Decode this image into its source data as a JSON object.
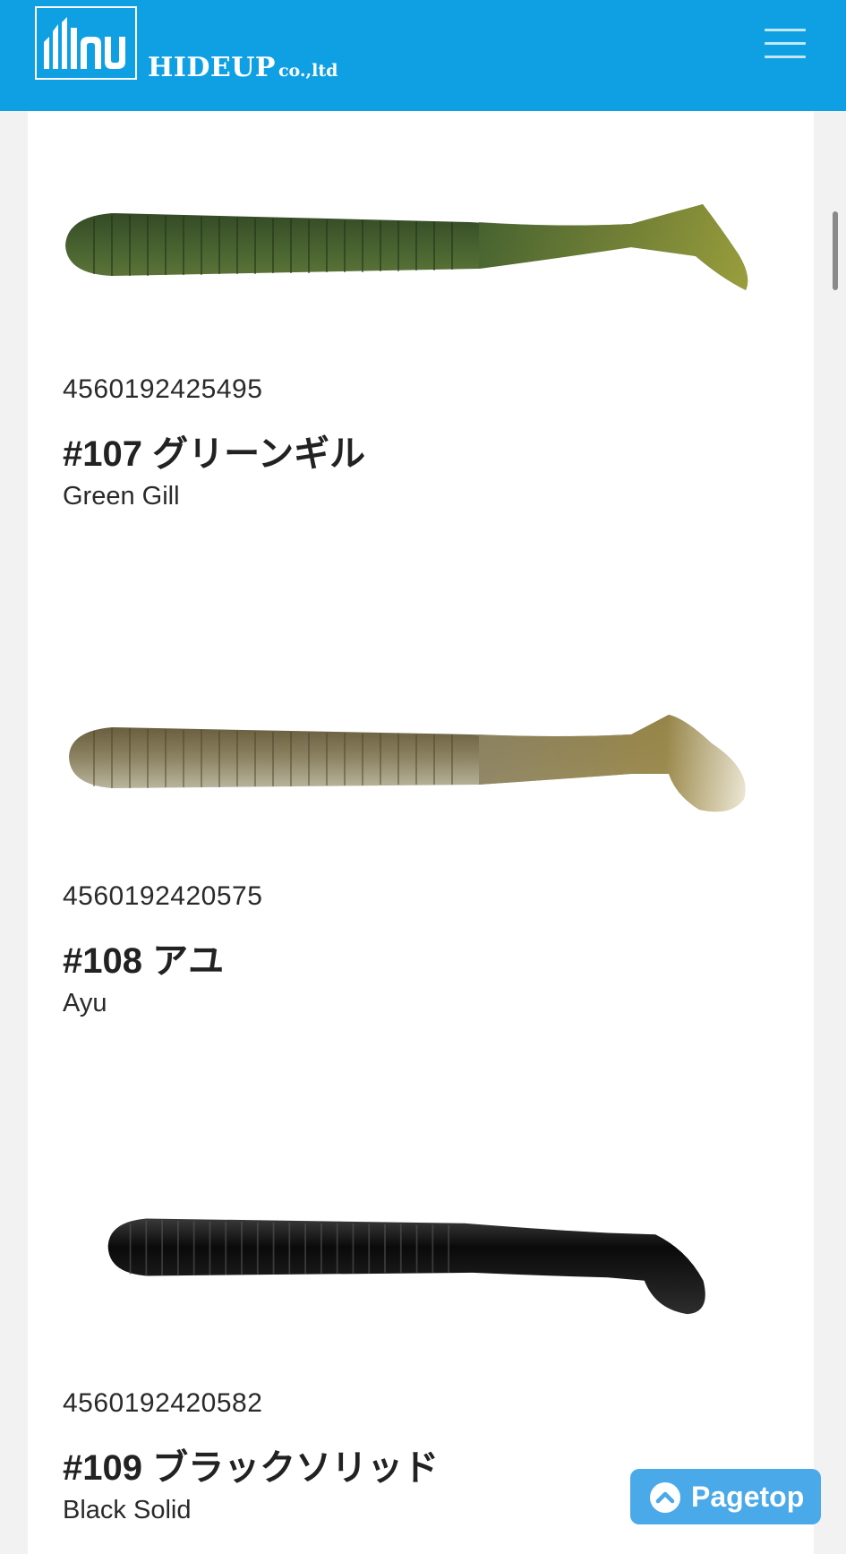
{
  "header": {
    "brand_name": "HIDEUP",
    "brand_suffix": "co.,ltd",
    "logo_letters": "hu",
    "menu_icon": "hamburger-menu-icon",
    "color": "#0fa0e3"
  },
  "products": [
    {
      "jan": "4560192425495",
      "title": "#107 グリーンギル",
      "name_en": "Green Gill",
      "lure_colors": {
        "body": "#4a6531",
        "back": "#2f4423",
        "belly": "#667c3c",
        "tail": "#a3a43d"
      }
    },
    {
      "jan": "4560192420575",
      "title": "#108 アユ",
      "name_en": "Ayu",
      "lure_colors": {
        "body": "#9a9270",
        "back": "#5a5030",
        "belly": "#dcdccd",
        "tail": "#c9b27a"
      }
    },
    {
      "jan": "4560192420582",
      "title": "#109 ブラックソリッド",
      "name_en": "Black Solid",
      "lure_colors": {
        "body": "#1c1c1c",
        "back": "#0a0a0a",
        "belly": "#2d2d2d",
        "tail": "#151515"
      }
    }
  ],
  "pagetop": {
    "label": "Pagetop",
    "icon": "chevron-up-icon"
  }
}
